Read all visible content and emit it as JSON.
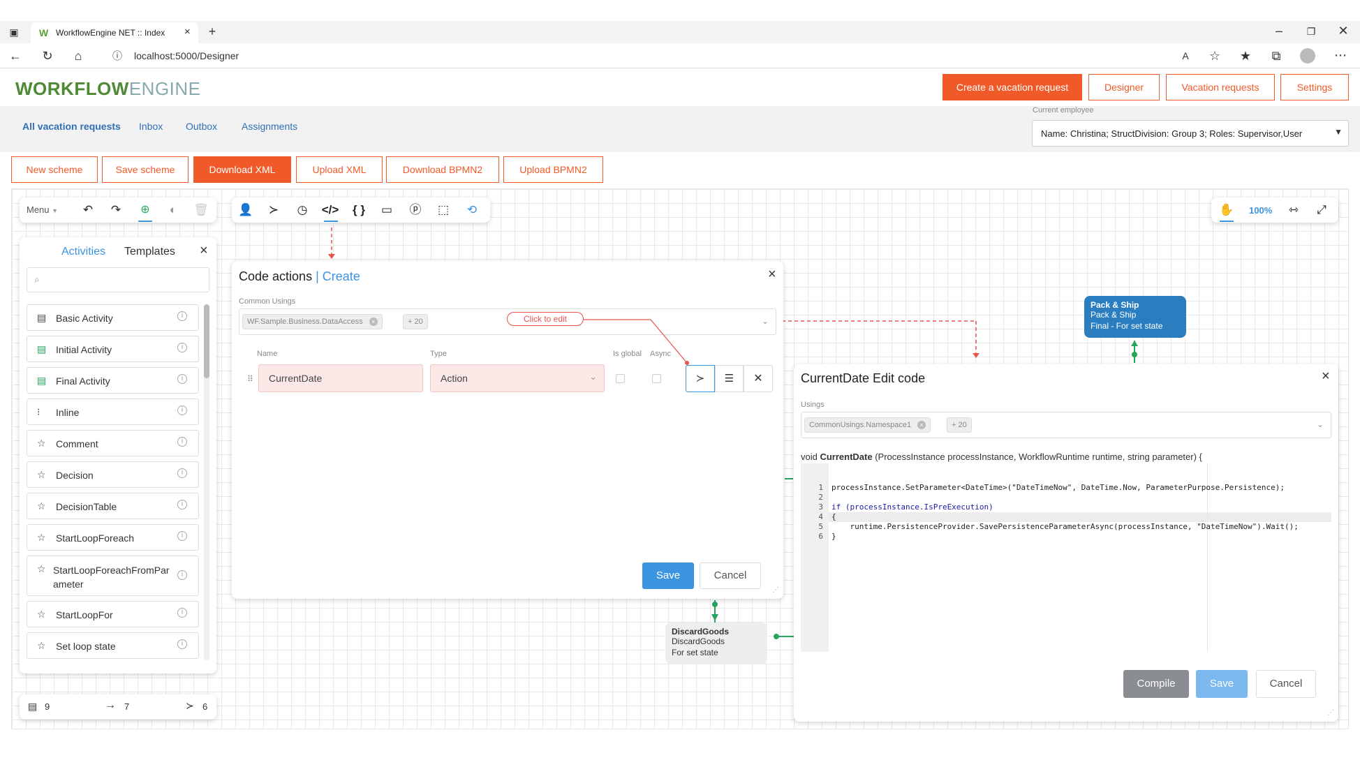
{
  "browser": {
    "tab_title": "WorkflowEngine NET :: Index",
    "url": "localhost:5000/Designer"
  },
  "header": {
    "logo_bold": "WORKFLOW",
    "logo_light": "ENGINE",
    "buttons": [
      "Create a vacation request",
      "Designer",
      "Vacation requests",
      "Settings"
    ]
  },
  "subnav": {
    "links": [
      "All vacation requests",
      "Inbox",
      "Outbox",
      "Assignments"
    ],
    "employee_label": "Current employee",
    "employee_value": "Name: Christina; StructDivision: Group 3; Roles: Supervisor,User"
  },
  "scheme_buttons": [
    "New scheme",
    "Save scheme",
    "Download XML",
    "Upload XML",
    "Download BPMN2",
    "Upload BPMN2"
  ],
  "left_toolbar": {
    "menu_label": "Menu"
  },
  "zoom": {
    "level": "100%"
  },
  "activities_panel": {
    "tabs": [
      "Activities",
      "Templates"
    ],
    "items": [
      "Basic Activity",
      "Initial Activity",
      "Final Activity",
      "Inline",
      "Comment",
      "Decision",
      "DecisionTable",
      "StartLoopForeach",
      "StartLoopForeachFromPar",
      "ameter",
      "StartLoopFor",
      "Set loop state"
    ]
  },
  "footer_counts": {
    "activities": "9",
    "transitions": "7",
    "actions": "6"
  },
  "code_actions": {
    "title": "Code actions",
    "mode": "Create",
    "common_usings_label": "Common Usings",
    "using_chip": "WF.Sample.Business.DataAccess",
    "more_chip": "+ 20",
    "click_to_edit": "Click to edit",
    "col_name": "Name",
    "col_type": "Type",
    "col_global": "Is global",
    "col_async": "Async",
    "row_name": "CurrentDate",
    "row_type": "Action",
    "save": "Save",
    "cancel": "Cancel"
  },
  "edit_code": {
    "title": "CurrentDate Edit code",
    "usings_label": "Usings",
    "using_chip": "CommonUsings.Namespace1",
    "more_chip": "+ 20",
    "signature_prefix": "void ",
    "signature_name": "CurrentDate",
    "signature_rest": " (ProcessInstance processInstance, WorkflowRuntime runtime, string parameter) {",
    "line_numbers": [
      "1",
      "2",
      "3",
      "4",
      "5",
      "6"
    ],
    "lines": [
      "processInstance.SetParameter<DateTime>(\"DateTimeNow\", DateTime.Now, ParameterPurpose.Persistence);",
      "",
      "if (processInstance.IsPreExecution)",
      "{",
      "    runtime.PersistenceProvider.SavePersistenceParameterAsync(processInstance, \"DateTimeNow\").Wait();",
      "}"
    ],
    "compile": "Compile",
    "save": "Save",
    "cancel": "Cancel"
  },
  "nodes": {
    "pack": {
      "line1": "Pack & Ship",
      "line2": "Pack & Ship",
      "line3": "Final - For set state"
    },
    "discard": {
      "line1": "DiscardGoods",
      "line2": "DiscardGoods",
      "line3": "For set state"
    }
  }
}
